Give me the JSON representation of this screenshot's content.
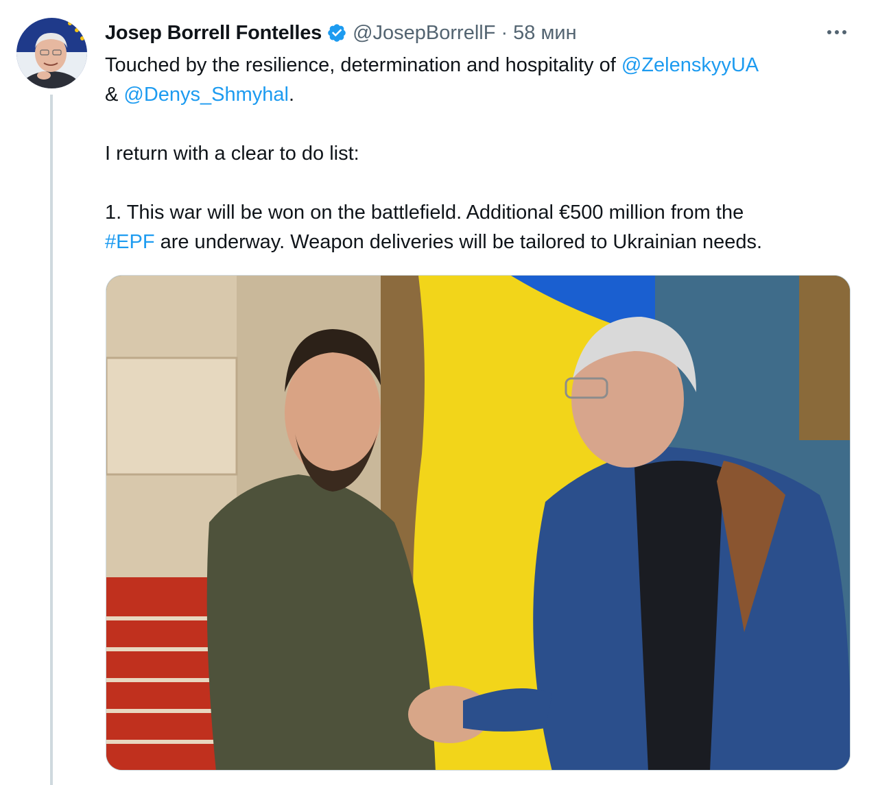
{
  "author": {
    "name": "Josep Borrell Fontelles",
    "handle": "@JosepBorrellF",
    "separator": "·",
    "time": "58 мин",
    "verified_icon": "verified-badge-icon",
    "avatar_icon": "profile-photo"
  },
  "menu": {
    "more_icon": "more-horizontal-icon"
  },
  "tweet": {
    "line1_text": "Touched by the resilience, determination and hospitality of ",
    "mention1": "@ZelenskyyUA",
    "line2_prefix": "& ",
    "mention2": "@Denys_Shmyhal",
    "line2_suffix": ".",
    "paragraph2": "I return with a clear to do list:",
    "point1_part1": "1. This war will be won on the battlefield. Additional €500 million from the ",
    "hashtag": "#EPF",
    "point1_part2": " are underway. Weapon deliveries will be tailored to Ukrainian needs."
  },
  "colors": {
    "link": "#1d9bf0",
    "secondary_text": "#536471",
    "primary_text": "#0f1419",
    "thread_line": "#cfd9de",
    "verified": "#1d9bf0"
  }
}
